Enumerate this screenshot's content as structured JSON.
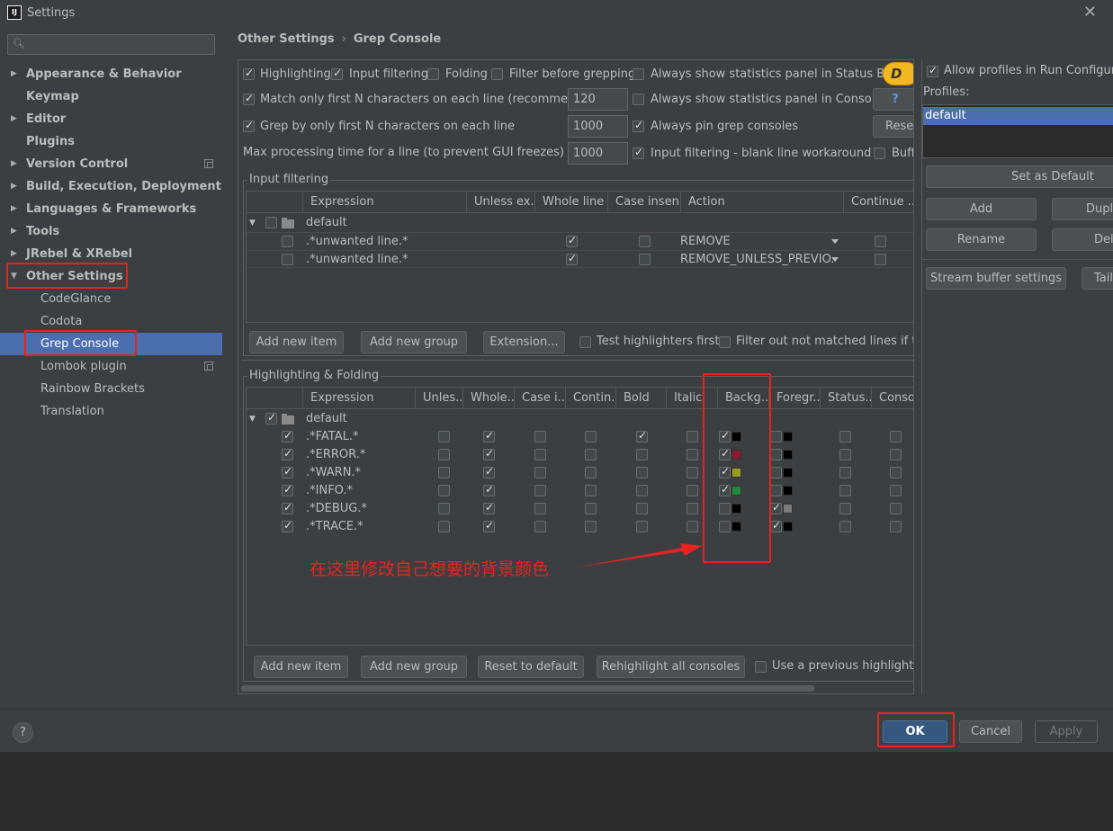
{
  "window": {
    "title": "Settings",
    "icon": "intellij-icon",
    "close_icon": "close-icon"
  },
  "search": {
    "placeholder": "",
    "icon": "search-icon"
  },
  "sidebar": {
    "items": [
      {
        "label": "Appearance & Behavior"
      },
      {
        "label": "Keymap"
      },
      {
        "label": "Editor"
      },
      {
        "label": "Plugins"
      },
      {
        "label": "Version Control"
      },
      {
        "label": "Build, Execution, Deployment"
      },
      {
        "label": "Languages & Frameworks"
      },
      {
        "label": "Tools"
      },
      {
        "label": "JRebel & XRebel"
      },
      {
        "label": "Other Settings"
      },
      {
        "label": "CodeGlance"
      },
      {
        "label": "Codota"
      },
      {
        "label": "Grep Console"
      },
      {
        "label": "Lombok plugin"
      },
      {
        "label": "Rainbow Brackets"
      },
      {
        "label": "Translation"
      }
    ]
  },
  "breadcrumb": {
    "parent": "Other Settings",
    "separator": "›",
    "current": "Grep Console"
  },
  "options": {
    "highlighting": "Highlighting",
    "input_filtering": "Input filtering",
    "folding": "Folding",
    "filter_before": "Filter before grepping",
    "always_status_bar": "Always show statistics panel in Status Bar",
    "match_first_n": "Match only first N characters on each line (recommended)",
    "match_first_n_value": "120",
    "always_console": "Always show statistics panel in Console",
    "grep_first_n": "Grep by only first N characters on each line",
    "grep_first_n_value": "1000",
    "always_pin": "Always pin grep consoles",
    "max_time": "Max processing time for a line (to prevent GUI freezes) [ms]",
    "max_time_value": "1000",
    "blank_line": "Input filtering - blank line workaround",
    "donate_badge": "D",
    "help_button": "?",
    "reset_button": "Reset",
    "buffer_label": "Buff"
  },
  "input_filtering": {
    "title": "Input filtering",
    "columns": [
      "Expression",
      "Unless ex...",
      "Whole line",
      "Case insen...",
      "Action",
      "Continue ..."
    ],
    "group": "default",
    "rows": [
      {
        "expression": ".*unwanted line.*",
        "action": "REMOVE"
      },
      {
        "expression": ".*unwanted line.*",
        "action": "REMOVE_UNLESS_PREVIO..."
      }
    ],
    "buttons": {
      "add_item": "Add new item",
      "add_group": "Add new group",
      "extension": "Extension..."
    },
    "test_first": "Test highlighters first",
    "filter_out": "Filter out not matched lines if the p"
  },
  "highlighting": {
    "title": "Highlighting & Folding",
    "columns": [
      "Expression",
      "Unles...",
      "Whole...",
      "Case i...",
      "Contin...",
      "Bold",
      "Italic",
      "Backg...",
      "Foregr...",
      "Status...",
      "Conso..."
    ],
    "group": "default",
    "rows": [
      {
        "expression": ".*FATAL.*",
        "bg_color": "#000000",
        "fg_color": "#000000"
      },
      {
        "expression": ".*ERROR.*",
        "bg_color": "#8b1a2b",
        "fg_color": "#000000"
      },
      {
        "expression": ".*WARN.*",
        "bg_color": "#9a9a1c",
        "fg_color": "#000000"
      },
      {
        "expression": ".*INFO.*",
        "bg_color": "#1f8a3a",
        "fg_color": "#000000"
      },
      {
        "expression": ".*DEBUG.*",
        "bg_color": "#000000",
        "fg_color": "#7a7a7a"
      },
      {
        "expression": ".*TRACE.*",
        "bg_color": "#000000",
        "fg_color": "#000000"
      }
    ],
    "buttons": {
      "add_item": "Add new item",
      "add_group": "Add new group",
      "reset": "Reset to default",
      "rehighlight": "Rehighlight all consoles"
    },
    "use_previous": "Use a previous highlight if a"
  },
  "profiles": {
    "allow": "Allow profiles in Run Configurati",
    "label": "Profiles:",
    "items": [
      "default"
    ],
    "buttons": {
      "set_default": "Set as Default",
      "add": "Add",
      "duplicate": "Dupli",
      "rename": "Rename",
      "delete": "Dele",
      "stream_buffer": "Stream buffer settings",
      "tail": "Tail"
    }
  },
  "annotation": {
    "text": "在这里修改自己想要的背景颜色",
    "color": "#e8231f"
  },
  "footer": {
    "help": "?",
    "ok": "OK",
    "cancel": "Cancel",
    "apply": "Apply"
  }
}
